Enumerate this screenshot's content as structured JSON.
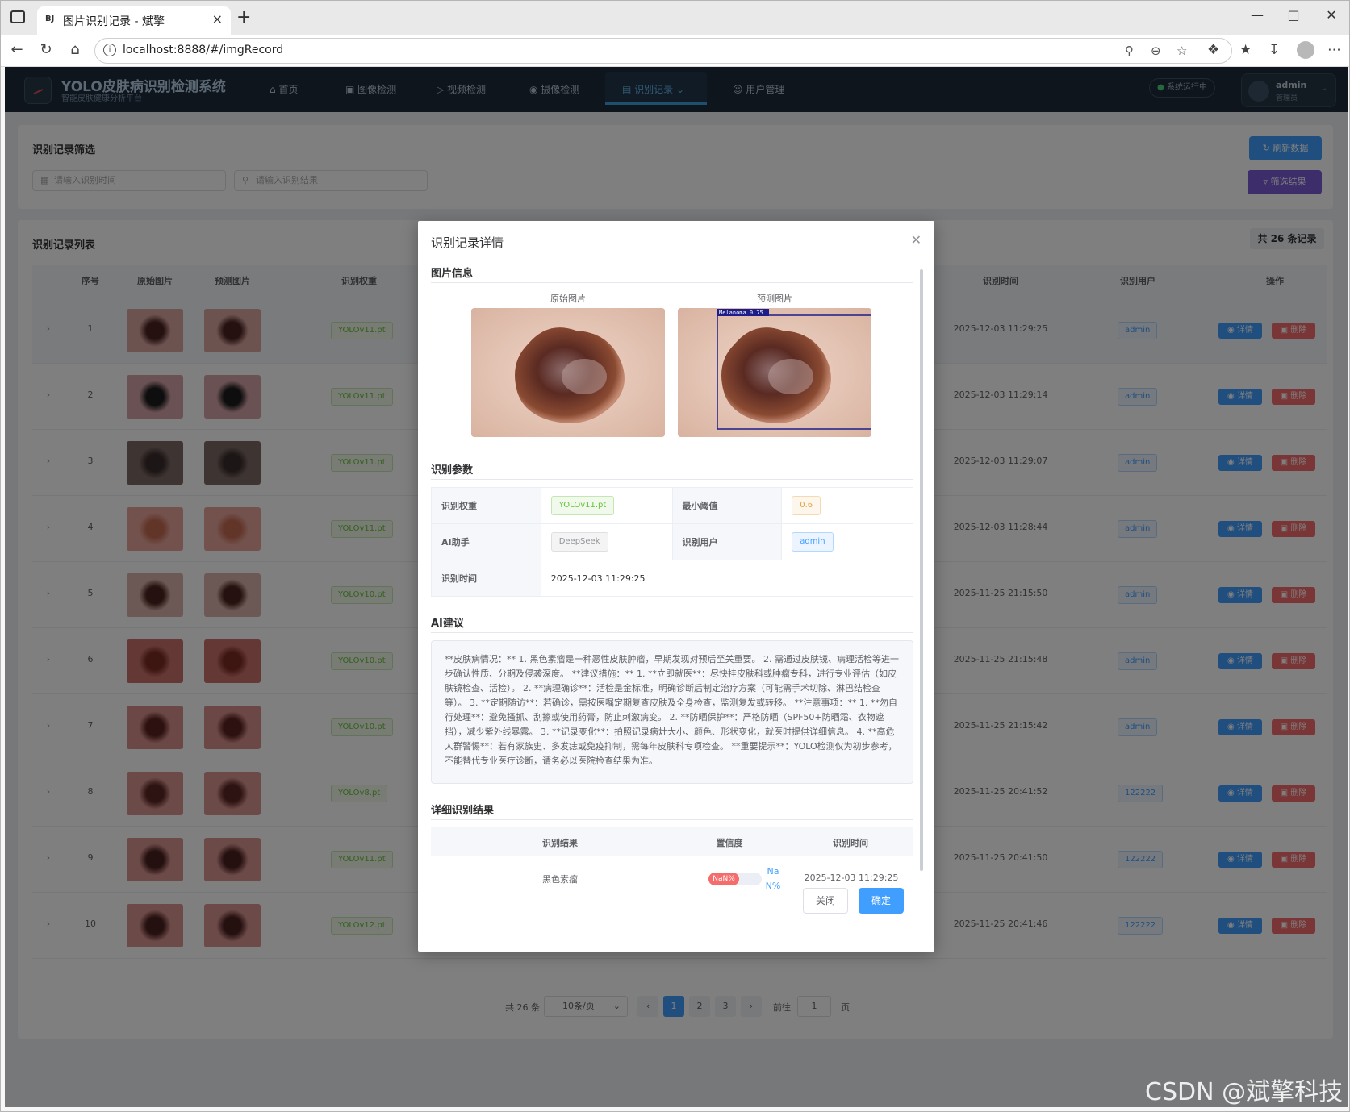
{
  "browser": {
    "tab_title": "图片识别记录 - 斌擎",
    "tab_favicon": "BJ",
    "url": "localhost:8888/#/imgRecord",
    "new_tab_glyph": "+",
    "close_glyph": "×"
  },
  "app": {
    "brand_title": "YOLO皮肤病识别检测系统",
    "brand_subtitle": "智能皮肤健康分析平台",
    "nav": [
      {
        "label": "首页",
        "icon": "home-icon"
      },
      {
        "label": "图像检测",
        "icon": "image-icon"
      },
      {
        "label": "视频检测",
        "icon": "video-icon"
      },
      {
        "label": "摄像检测",
        "icon": "camera-icon"
      },
      {
        "label": "识别记录",
        "icon": "record-icon",
        "active": true
      },
      {
        "label": "用户管理",
        "icon": "user-icon"
      }
    ],
    "system_status": "系统运行中",
    "user_name": "admin",
    "user_role": "管理员"
  },
  "filter": {
    "title": "识别记录筛选",
    "time_placeholder": "请输入识别时间",
    "result_placeholder": "请输入识别结果",
    "refresh_label": "刷新数据",
    "filter_label": "筛选结果"
  },
  "list": {
    "title": "识别记录列表",
    "total_badge": "共 26 条记录",
    "columns": [
      "序号",
      "原始图片",
      "预测图片",
      "识别权重",
      "识别时间",
      "识别用户",
      "操作"
    ],
    "detail_label": "详情",
    "delete_label": "删除",
    "rows": [
      {
        "no": "1",
        "weight": "YOLOv11.pt",
        "time": "2025-12-03 11:29:25",
        "user": "admin"
      },
      {
        "no": "2",
        "weight": "YOLOv11.pt",
        "time": "2025-12-03 11:29:14",
        "user": "admin"
      },
      {
        "no": "3",
        "weight": "YOLOv11.pt",
        "time": "2025-12-03 11:29:07",
        "user": "admin"
      },
      {
        "no": "4",
        "weight": "YOLOv11.pt",
        "time": "2025-12-03 11:28:44",
        "user": "admin"
      },
      {
        "no": "5",
        "weight": "YOLOv10.pt",
        "time": "2025-11-25 21:15:50",
        "user": "admin"
      },
      {
        "no": "6",
        "weight": "YOLOv10.pt",
        "time": "2025-11-25 21:15:48",
        "user": "admin"
      },
      {
        "no": "7",
        "weight": "YOLOv10.pt",
        "time": "2025-11-25 21:15:42",
        "user": "admin"
      },
      {
        "no": "8",
        "weight": "YOLOv8.pt",
        "time": "2025-11-25 20:41:52",
        "user": "122222"
      },
      {
        "no": "9",
        "weight": "YOLOv11.pt",
        "time": "2025-11-25 20:41:50",
        "user": "122222"
      },
      {
        "no": "10",
        "weight": "YOLOv12.pt",
        "time": "2025-11-25 20:41:46",
        "user": "122222"
      }
    ]
  },
  "pager": {
    "total": "共 26 条",
    "page_size": "10条/页",
    "pages": [
      "1",
      "2",
      "3"
    ],
    "current": "1",
    "goto_prefix": "前往",
    "goto_value": "1",
    "goto_suffix": "页"
  },
  "dialog": {
    "title": "识别记录详情",
    "section_images": "图片信息",
    "caption_original": "原始图片",
    "caption_predicted": "预测图片",
    "detection_label": "Melanoma 0.75",
    "section_params": "识别参数",
    "params": {
      "weight_label": "识别权重",
      "weight_value": "YOLOv11.pt",
      "threshold_label": "最小阈值",
      "threshold_value": "0.6",
      "ai_label": "AI助手",
      "ai_value": "DeepSeek",
      "user_label": "识别用户",
      "user_value": "admin",
      "time_label": "识别时间",
      "time_value": "2025-12-03 11:29:25"
    },
    "section_ai": "AI建议",
    "ai_text": "**皮肤病情况：** 1. 黑色素瘤是一种恶性皮肤肿瘤，早期发现对预后至关重要。 2. 需通过皮肤镜、病理活检等进一步确认性质、分期及侵袭深度。 **建议措施：** 1. **立即就医**：尽快挂皮肤科或肿瘤专科，进行专业评估（如皮肤镜检查、活检）。 2. **病理确诊**：活检是金标准，明确诊断后制定治疗方案（可能需手术切除、淋巴结检查等）。 3. **定期随访**：若确诊，需按医嘱定期复查皮肤及全身检查，监测复发或转移。 **注意事项：** 1. **勿自行处理**：避免搔抓、刮擦或使用药膏，防止刺激病变。 2. **防晒保护**：严格防晒（SPF50+防晒霜、衣物遮挡），减少紫外线暴露。 3. **记录变化**：拍照记录病灶大小、颜色、形状变化，就医时提供详细信息。 4. **高危人群警惕**：若有家族史、多发痣或免疫抑制，需每年皮肤科专项检查。 **重要提示**：YOLO检测仅为初步参考，不能替代专业医疗诊断，请务必以医院检查结果为准。",
    "section_results": "详细识别结果",
    "result_columns": [
      "识别结果",
      "置信度",
      "识别时间"
    ],
    "result_row": {
      "label": "黑色素瘤",
      "badge": "NaN%",
      "confidence_text_1": "Na",
      "confidence_text_2": "N%",
      "time": "2025-12-03 11:29:25"
    },
    "close_label": "关闭",
    "confirm_label": "确定"
  },
  "watermark": "CSDN @斌擎科技",
  "colors": {
    "primary": "#409eff",
    "danger": "#f56c6c",
    "success": "#67c23a",
    "nav_bg": "#1c2a3a",
    "accent": "#3aa0d8"
  }
}
